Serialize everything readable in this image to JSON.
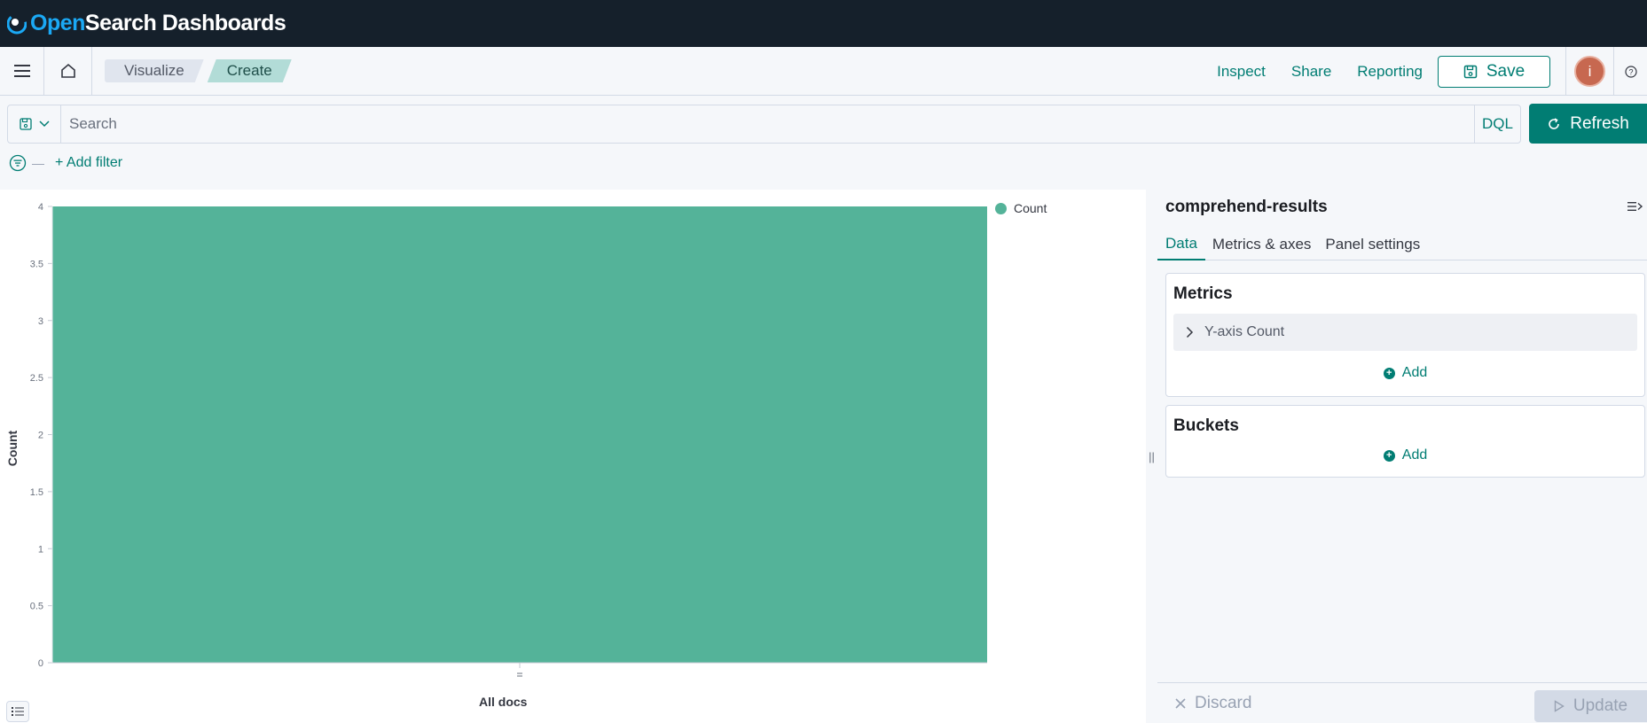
{
  "app": {
    "logo_open": "Open",
    "logo_rest": "Search Dashboards"
  },
  "navbar": {
    "breadcrumbs": [
      "Visualize",
      "Create"
    ],
    "links": [
      "Inspect",
      "Share",
      "Reporting"
    ],
    "save_label": "Save",
    "avatar_initial": "i"
  },
  "query": {
    "placeholder": "Search",
    "language": "DQL",
    "refresh_label": "Refresh",
    "add_filter": "+ Add filter"
  },
  "chart_data": {
    "type": "bar",
    "categories": [
      "All docs"
    ],
    "series": [
      {
        "name": "Count",
        "values": [
          4
        ]
      }
    ],
    "xlabel": "All docs",
    "ylabel": "Count",
    "ylim": [
      0,
      4
    ],
    "yticks": [
      "0",
      "0.5",
      "1",
      "1.5",
      "2",
      "2.5",
      "3",
      "3.5",
      "4"
    ],
    "legend_position": "top-right",
    "color": "#54b399"
  },
  "editor": {
    "title": "comprehend-results",
    "tabs": [
      "Data",
      "Metrics & axes",
      "Panel settings"
    ],
    "metrics_title": "Metrics",
    "metric_agg": "Y-axis Count",
    "add_label": "Add",
    "buckets_title": "Buckets",
    "discard_label": "Discard",
    "update_label": "Update"
  }
}
